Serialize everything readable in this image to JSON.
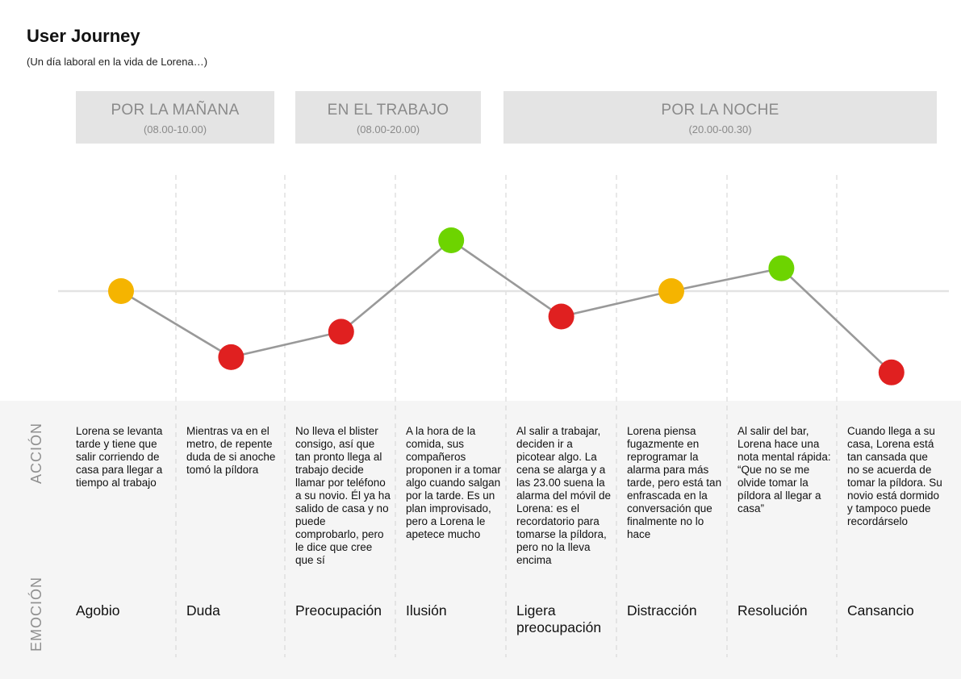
{
  "header": {
    "title": "User Journey",
    "subtitle": "(Un día laboral en la vida de Lorena…)"
  },
  "phases": [
    {
      "name": "POR LA MAÑANA",
      "time": "(08.00-10.00)"
    },
    {
      "name": "EN EL TRABAJO",
      "time": "(08.00-20.00)"
    },
    {
      "name": "POR LA NOCHE",
      "time": "(20.00-00.30)"
    }
  ],
  "row_labels": {
    "accion": "ACCIÓN",
    "emocion": "EMOCIÓN"
  },
  "colors": {
    "positive": "#6dd400",
    "neutral": "#f5b400",
    "negative": "#e02020",
    "line": "#999999",
    "baseline": "#e3e3e3",
    "separator": "#d8d8d8",
    "phase_bg": "#e4e4e4"
  },
  "chart_data": {
    "type": "line",
    "levels": {
      "high": 1,
      "neutral": 0,
      "low": -1
    },
    "steps": [
      {
        "emotion": "Agobio",
        "level": 0,
        "color": "neutral",
        "action": "Lorena se levanta tarde y tiene que salir corriendo de casa para llegar a tiempo al trabajo"
      },
      {
        "emotion": "Duda",
        "level": -1.3,
        "color": "negative",
        "action": "Mientras va en el metro, de repente duda de si anoche tomó la píldora"
      },
      {
        "emotion": "Preocupación",
        "level": -0.8,
        "color": "negative",
        "action": "No lleva el blister consigo, así que tan pronto llega al trabajo decide llamar por teléfono a su novio. Él ya ha salido de casa y no puede comprobarlo, pero le dice que cree que sí"
      },
      {
        "emotion": "Ilusión",
        "level": 1,
        "color": "positive",
        "action": "A la hora de la comida, sus compañeros proponen ir a tomar algo cuando salgan por la tarde. Es un plan improvisado, pero a Lorena le apetece mucho"
      },
      {
        "emotion": "Ligera preocupación",
        "level": -0.5,
        "color": "negative",
        "action": "Al salir a trabajar, deciden ir a picotear algo. La cena se alarga y a las 23.00 suena la alarma del móvil de Lorena: es el recordatorio para tomarse la píldora, pero no la lleva encima"
      },
      {
        "emotion": "Distracción",
        "level": 0,
        "color": "neutral",
        "action": "Lorena piensa fugazmente en reprogramar la alarma para más tarde, pero está tan enfrascada en la conversación que finalmente no lo hace"
      },
      {
        "emotion": "Resolución",
        "level": 0.45,
        "color": "positive",
        "action": "Al salir del bar, Lorena hace una nota mental rápida: “Que no se me olvide tomar la píldora al llegar a casa”"
      },
      {
        "emotion": "Cansancio",
        "level": -1.6,
        "color": "negative",
        "action": "Cuando llega a su casa, Lorena está tan cansada que no se acuerda de tomar la píldora. Su novio está dormido y tampoco puede recordárselo"
      }
    ]
  }
}
